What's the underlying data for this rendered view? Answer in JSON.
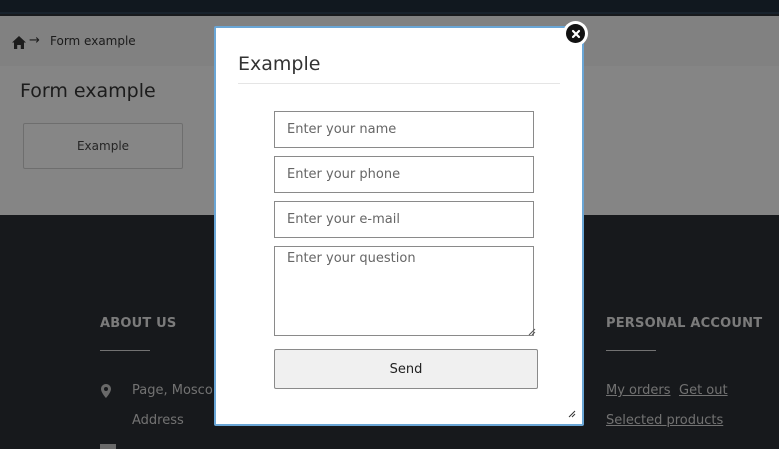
{
  "breadcrumb": {
    "separator": "→",
    "current": "Form example"
  },
  "page": {
    "title": "Form example",
    "example_button": "Example"
  },
  "footer": {
    "about": {
      "heading": "ABOUT US",
      "address_line1": "Page, Mosco",
      "address_line2": "Address"
    },
    "account": {
      "heading": "PERSONAL ACCOUNT",
      "my_orders": "My orders",
      "get_out": "Get out",
      "selected_products": "Selected products"
    }
  },
  "modal": {
    "title": "Example",
    "name_placeholder": "Enter your name",
    "phone_placeholder": "Enter your phone",
    "email_placeholder": "Enter your e-mail",
    "question_placeholder": "Enter your question",
    "send_label": "Send"
  },
  "icons": {
    "home": "home-icon",
    "pin": "map-pin-icon",
    "close": "close-icon",
    "resize": "resize-grip-icon"
  },
  "colors": {
    "modal_border": "#6aa6d6",
    "footer_bg": "#2b2e33",
    "topbar_bg": "#1f2c39"
  }
}
